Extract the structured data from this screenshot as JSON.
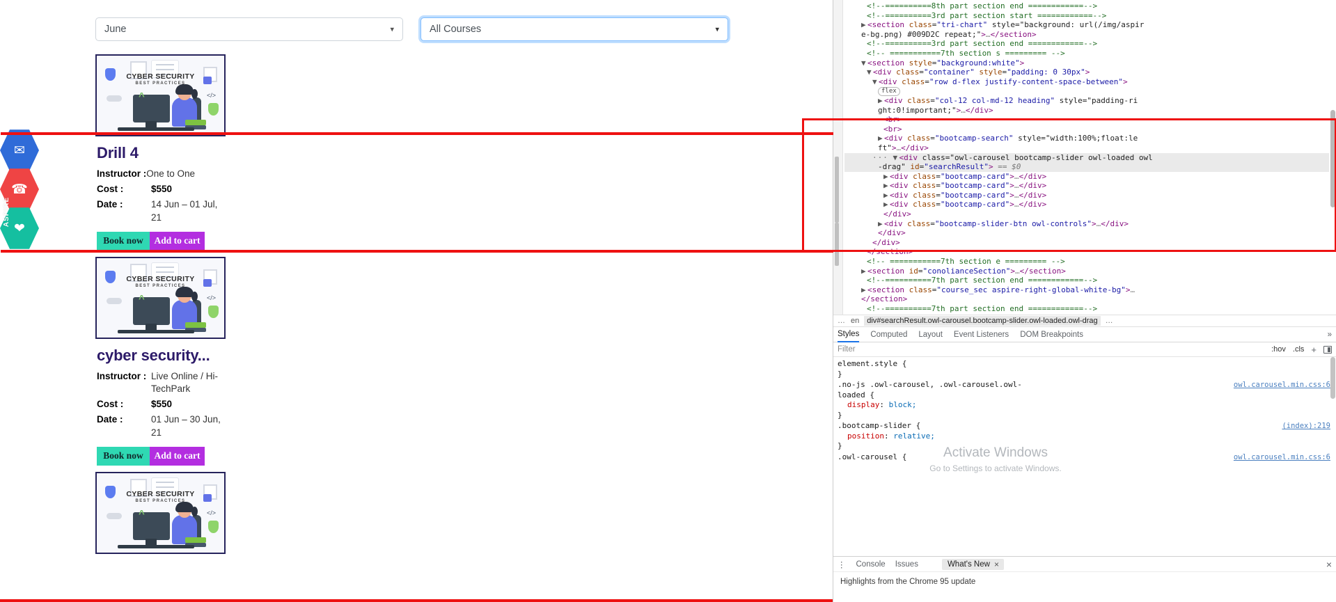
{
  "page": {
    "filters": {
      "month": {
        "value": "June",
        "caret": "chevron-down-icon"
      },
      "course": {
        "value": "All Courses",
        "caret": "chevron-down-icon"
      }
    },
    "social_rail": [
      {
        "name": "mail",
        "glyph": "✉",
        "color": "#2f6bd8"
      },
      {
        "name": "phone",
        "glyph": "☎",
        "color": "#ef4444"
      },
      {
        "name": "share",
        "glyph": "❤",
        "color": "#15bfa0"
      }
    ],
    "aspire_label": "ASPIRE",
    "illustration": {
      "title": "CYBER SECURITY",
      "subtitle": "BEST PRACTICES",
      "code": "</>",
      "caret": "^"
    },
    "cards": [
      {
        "title": "Drill 4",
        "instructor_label": "Instructor :",
        "instructor": "One to One",
        "cost_label": "Cost :",
        "cost": "$550",
        "date_label": "Date :",
        "date": "14 Jun – 01 Jul, 21",
        "book_label": "Book now",
        "cart_label": "Add to cart"
      },
      {
        "title": "cyber security...",
        "instructor_label": "Instructor :",
        "instructor": "Live Online / Hi-TechPark",
        "cost_label": "Cost :",
        "cost": "$550",
        "date_label": "Date :",
        "date": "01 Jun – 30 Jun, 21",
        "book_label": "Book now",
        "cart_label": "Add to cart"
      },
      {
        "title": "",
        "instructor_label": "",
        "instructor": "",
        "cost_label": "",
        "cost": "",
        "date_label": "",
        "date": "",
        "book_label": "",
        "cart_label": ""
      }
    ]
  },
  "devtools": {
    "tree": [
      {
        "indent": 4,
        "type": "comment",
        "text": "<!--==========8th part section end ============-->"
      },
      {
        "indent": 4,
        "type": "comment",
        "text": "<!--==========3rd part section start ============-->"
      },
      {
        "indent": 3,
        "type": "node",
        "arrow": "▶",
        "text": "<section class=\"tri-chart\" style=\"background: url(/img/aspir"
      },
      {
        "indent": 3,
        "type": "cont",
        "text": "e-bg.png) #009D2C repeat;\">…</section>"
      },
      {
        "indent": 4,
        "type": "comment",
        "text": "<!--==========3rd part section end ============-->"
      },
      {
        "indent": 4,
        "type": "comment",
        "text": "<!-- ===========7th section s ========= -->"
      },
      {
        "indent": 3,
        "type": "node",
        "arrow": "▼",
        "text": "<section style=\"background:white\">"
      },
      {
        "indent": 4,
        "type": "node",
        "arrow": "▼",
        "text": "<div class=\"container\" style=\"padding: 0 30px\">"
      },
      {
        "indent": 5,
        "type": "node",
        "arrow": "▼",
        "text": "<div class=\"row d-flex justify-content-space-between\">"
      },
      {
        "indent": 6,
        "type": "badge",
        "text": "flex"
      },
      {
        "indent": 6,
        "type": "node",
        "arrow": "▶",
        "text": "<div class=\"col-12 col-md-12 heading\" style=\"padding-ri"
      },
      {
        "indent": 6,
        "type": "cont",
        "text": "ght:0!important;\">…</div>"
      },
      {
        "indent": 7,
        "type": "plain",
        "text": "<br>"
      },
      {
        "indent": 7,
        "type": "plain",
        "text": "<br>"
      },
      {
        "indent": 6,
        "type": "node",
        "arrow": "▶",
        "text": "<div class=\"bootcamp-search\" style=\"width:100%;float:le"
      },
      {
        "indent": 6,
        "type": "cont",
        "text": "ft\">…</div>"
      },
      {
        "indent": 6,
        "type": "selected",
        "arrow": "▼",
        "text": "<div class=\"owl-carousel bootcamp-slider owl-loaded owl"
      },
      {
        "indent": 6,
        "type": "selcont",
        "text": "-drag\" id=\"searchResult\"> == $0"
      },
      {
        "indent": 7,
        "type": "node",
        "arrow": "▶",
        "text": "<div class=\"bootcamp-card\">…</div>"
      },
      {
        "indent": 7,
        "type": "node",
        "arrow": "▶",
        "text": "<div class=\"bootcamp-card\">…</div>"
      },
      {
        "indent": 7,
        "type": "node",
        "arrow": "▶",
        "text": "<div class=\"bootcamp-card\">…</div>"
      },
      {
        "indent": 7,
        "type": "node",
        "arrow": "▶",
        "text": "<div class=\"bootcamp-card\">…</div>"
      },
      {
        "indent": 7,
        "type": "plain",
        "text": "</div>"
      },
      {
        "indent": 6,
        "type": "node",
        "arrow": "▶",
        "text": "<div class=\"bootcamp-slider-btn owl-controls\">…</div>"
      },
      {
        "indent": 6,
        "type": "plain",
        "text": "</div>"
      },
      {
        "indent": 5,
        "type": "plain",
        "text": "</div>"
      },
      {
        "indent": 4,
        "type": "plain",
        "text": "</section>"
      },
      {
        "indent": 4,
        "type": "comment",
        "text": "<!-- ===========7th section e ========= -->"
      },
      {
        "indent": 3,
        "type": "node",
        "arrow": "▶",
        "text": "<section id=\"conolianceSection\">…</section>"
      },
      {
        "indent": 4,
        "type": "comment",
        "text": "<!--==========7th part section end ============-->"
      },
      {
        "indent": 3,
        "type": "node",
        "arrow": "▶",
        "text": "<section class=\"course_sec aspire-right-global-white-bg\">…"
      },
      {
        "indent": 3,
        "type": "plain",
        "text": "</section>"
      },
      {
        "indent": 4,
        "type": "comment",
        "text": "<!--==========7th part section end ============-->"
      }
    ],
    "breadcrumb": {
      "ellipsis": "…",
      "en": "en",
      "active": "div#searchResult.owl-carousel.bootcamp-slider.owl-loaded.owl-drag",
      "trail_more": "…"
    },
    "styles_tabs": [
      {
        "label": "Styles",
        "active": true
      },
      {
        "label": "Computed",
        "active": false
      },
      {
        "label": "Layout",
        "active": false
      },
      {
        "label": "Event Listeners",
        "active": false
      },
      {
        "label": "DOM Breakpoints",
        "active": false
      }
    ],
    "styles_more": "»",
    "filter": {
      "placeholder": "Filter",
      "hov": ":hov",
      "cls": ".cls",
      "plus": "+",
      "panel_icon": "side-panel-icon"
    },
    "rules": [
      {
        "selector": "element.style {",
        "source": "",
        "decls": [],
        "close": "}"
      },
      {
        "selector": ".no-js .owl-carousel, .owl-carousel.owl-",
        "selector2": "loaded {",
        "source": "owl.carousel.min.css:6",
        "decls": [
          {
            "prop": "display",
            "value": "block;"
          }
        ],
        "close": "}"
      },
      {
        "selector": ".bootcamp-slider {",
        "source": "(index):219",
        "decls": [
          {
            "prop": "position",
            "value": "relative;"
          }
        ],
        "close": "}"
      },
      {
        "selector": ".owl-carousel {",
        "source": "owl.carousel.min.css:6",
        "decls": [],
        "close": ""
      }
    ],
    "drawer": {
      "kebab": "⋮",
      "tabs": [
        {
          "label": "Console",
          "active": true
        },
        {
          "label": "Issues",
          "active": false
        }
      ],
      "whats_new": "What's New",
      "whats_new_close": "×",
      "close": "×",
      "body": "Highlights from the Chrome 95 update"
    }
  },
  "watermark": {
    "line1": "Activate Windows",
    "line2": "Go to Settings to activate Windows."
  }
}
